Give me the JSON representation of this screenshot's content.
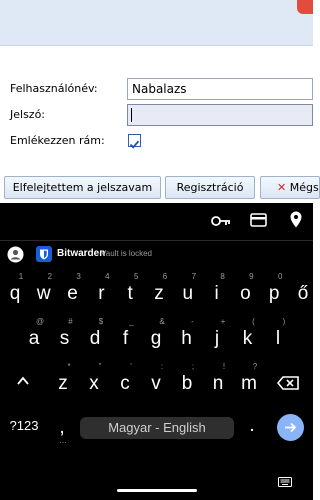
{
  "form": {
    "username_label": "Felhasználónév:",
    "username_value": "Nabalazs",
    "password_label": "Jelszó:",
    "password_value": "",
    "remember_label": "Emlékezzen rám:",
    "remember_checked": true
  },
  "buttons": {
    "forgot": "Elfelejtettem a jelszavam",
    "register": "Regisztráció",
    "cancel": "Mégs"
  },
  "autofill": {
    "app_name": "Bitwarden",
    "status": "Vault is locked"
  },
  "keyboard": {
    "row1": [
      "q",
      "w",
      "e",
      "r",
      "t",
      "z",
      "u",
      "i",
      "o",
      "p",
      "ő"
    ],
    "row1_hints": [
      "1",
      "2",
      "3",
      "4",
      "5",
      "6",
      "7",
      "8",
      "9",
      "0",
      ""
    ],
    "row2": [
      "a",
      "s",
      "d",
      "f",
      "g",
      "h",
      "j",
      "k",
      "l"
    ],
    "row2_hints": [
      "@",
      "#",
      "$",
      "_",
      "&",
      "-",
      "+",
      "(",
      ")"
    ],
    "row3": [
      "z",
      "x",
      "c",
      "v",
      "b",
      "n",
      "m"
    ],
    "row3_hints": [
      "*",
      "\"",
      "'",
      ":",
      ";",
      "!",
      "?"
    ],
    "symbols_key": "?123",
    "comma_key": ",",
    "space_label": "Magyar - English",
    "period_key": "."
  },
  "colors": {
    "page_bg": "#ffffff",
    "topbar": "#dfe9f6",
    "keyboard_bg": "#000000",
    "enter_key": "#8ab4f8",
    "bitwarden_blue": "#175ddc"
  }
}
